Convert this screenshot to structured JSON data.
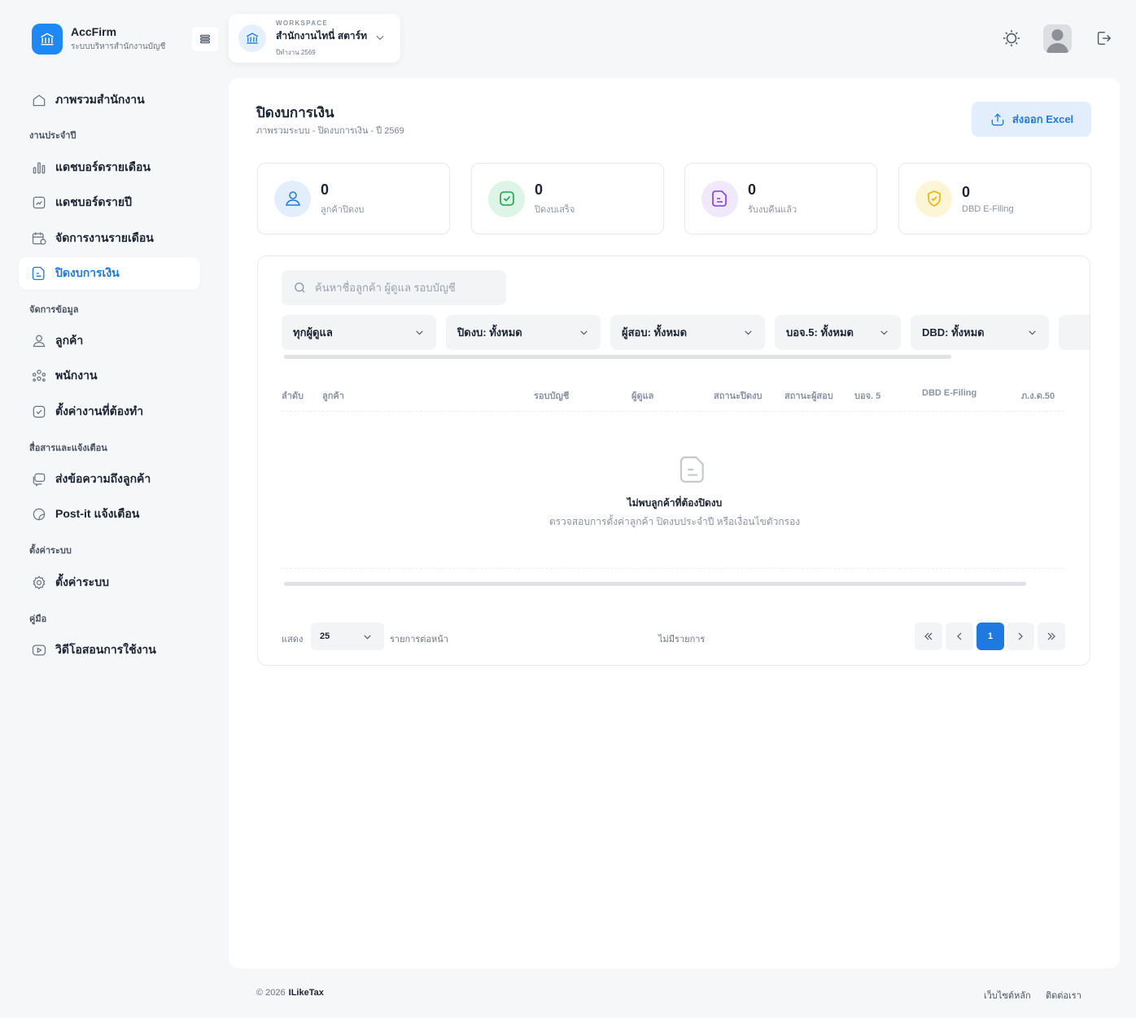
{
  "brand": {
    "name": "AccFirm",
    "subtitle": "ระบบบริหารสำนักงานบัญชี"
  },
  "workspace": {
    "caption": "WORKSPACE",
    "name": "สำนักงานไทนี่ สตาร์ท",
    "year": "ปีทำงาน 2569"
  },
  "sidebar": {
    "overview": "ภาพรวมสำนักงาน",
    "section_daily": "งานประจำปี",
    "dash_monthly": "แดชบอร์ดรายเดือน",
    "dash_yearly": "แดชบอร์ดรายปี",
    "monthly_jobs": "จัดการงานรายเดือน",
    "closing": "ปิดงบการเงิน",
    "section_data": "จัดการข้อมูล",
    "customers": "ลูกค้า",
    "employees": "พนักงาน",
    "todo_settings": "ตั้งค่างานที่ต้องทำ",
    "section_comm": "สื่อสารและแจ้งเตือน",
    "message_customers": "ส่งข้อความถึงลูกค้า",
    "postit": "Post-it แจ้งเตือน",
    "section_settings": "ตั้งค่าระบบ",
    "settings": "ตั้งค่าระบบ",
    "section_manual": "คู่มือ",
    "videos": "วิดีโอสอนการใช้งาน"
  },
  "page": {
    "title": "ปิดงบการเงิน",
    "breadcrumb": "ภาพรวมระบบ  -  ปิดงบการเงิน  -  ปี 2569",
    "export_label": "ส่งออก Excel"
  },
  "stats": [
    {
      "value": "0",
      "label": "ลูกค้าปิดงบ",
      "color": "#1e7ae0"
    },
    {
      "value": "0",
      "label": "ปิดงบเสร็จ",
      "color": "#16a34a"
    },
    {
      "value": "0",
      "label": "รับงบคืนแล้ว",
      "color": "#7c3aed"
    },
    {
      "value": "0",
      "label": "DBD E-Filing",
      "color": "#eab308"
    }
  ],
  "search": {
    "placeholder": "ค้นหาชื่อลูกค้า ผู้ดูแล รอบบัญชี"
  },
  "filters": [
    "ทุกผู้ดูแล",
    "ปิดงบ: ทั้งหมด",
    "ผู้สอบ: ทั้งหมด",
    "บอจ.5: ทั้งหมด",
    "DBD: ทั้งหมด"
  ],
  "table": {
    "columns": [
      "ลำดับ",
      "ลูกค้า",
      "รอบบัญชี",
      "ผู้ดูแล",
      "สถานะปิดงบ",
      "สถานะผู้สอบ",
      "บอจ. 5",
      "DBD E-Filing",
      "ภ.ง.ด.50"
    ],
    "empty_title": "ไม่พบลูกค้าที่ต้องปิดงบ",
    "empty_subtitle": "ตรวจสอบการตั้งค่าลูกค้า ปิดงบประจำปี หรือเงื่อนไขตัวกรอง"
  },
  "pagination": {
    "show": "แสดง",
    "per_page": "25",
    "per_page_suffix": "รายการต่อหน้า",
    "status": "ไม่มีรายการ",
    "current_page": "1"
  },
  "footer": {
    "copyright": "© 2026",
    "company": "ILikeTax",
    "home": "เว็บไซต์หลัก",
    "contact": "ติดต่อเรา"
  },
  "colors": {
    "accent": "#1e7ae0",
    "brand": "#1e88f5"
  }
}
